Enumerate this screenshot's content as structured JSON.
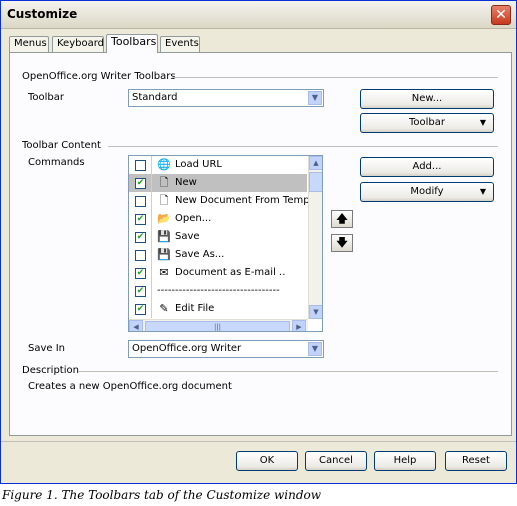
{
  "window": {
    "title": "Customize",
    "close": "✕"
  },
  "tabs": [
    {
      "label": "Menus"
    },
    {
      "label": "Keyboard"
    },
    {
      "label": "Toolbars"
    },
    {
      "label": "Events"
    }
  ],
  "toolbars_section": {
    "heading": "OpenOffice.org Writer Toolbars",
    "toolbar_label": "Toolbar",
    "toolbar_value": "Standard",
    "new_button": "New...",
    "toolbar_button": "Toolbar"
  },
  "content_section": {
    "heading": "Toolbar Content",
    "commands_label": "Commands",
    "add_button": "Add...",
    "modify_button": "Modify",
    "move_up": "🡅",
    "move_down": "🡇",
    "commands": [
      {
        "checked": false,
        "label": "Load URL",
        "icon": "globe-icon"
      },
      {
        "checked": true,
        "label": "New",
        "icon": "new-doc-icon",
        "selected": true
      },
      {
        "checked": false,
        "label": "New Document From Templa",
        "icon": "new-doc-icon"
      },
      {
        "checked": true,
        "label": "Open...",
        "icon": "folder-icon"
      },
      {
        "checked": true,
        "label": "Save",
        "icon": "save-icon"
      },
      {
        "checked": false,
        "label": "Save As...",
        "icon": "save-icon"
      },
      {
        "checked": true,
        "label": "Document as E-mail ..",
        "icon": "mail-icon"
      },
      {
        "checked": true,
        "label": "----------------------------------",
        "icon": ""
      },
      {
        "checked": true,
        "label": "Edit File",
        "icon": "edit-icon"
      }
    ],
    "save_in_label": "Save In",
    "save_in_value": "OpenOffice.org Writer"
  },
  "description_section": {
    "heading": "Description",
    "text": "Creates a new OpenOffice.org document"
  },
  "footer": {
    "ok": "OK",
    "cancel": "Cancel",
    "help": "Help",
    "reset": "Reset"
  },
  "caption": "Figure 1. The Toolbars tab of the Customize window"
}
